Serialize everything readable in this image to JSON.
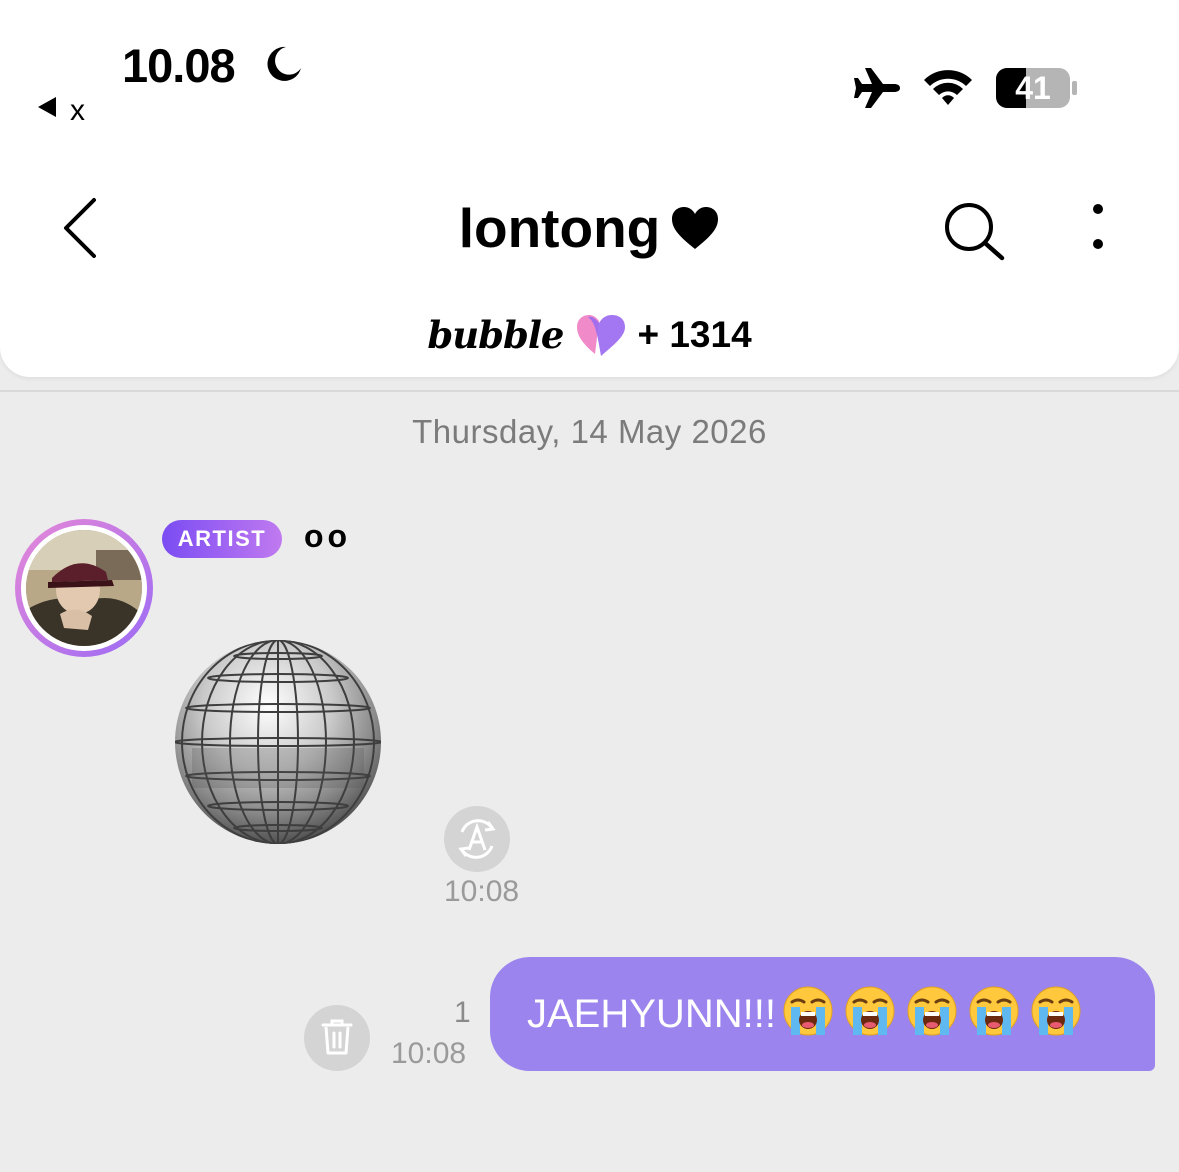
{
  "status_bar": {
    "time": "10.08",
    "back_app_label": "x",
    "battery_level": "41",
    "icons": [
      "moon-icon",
      "back-triangle-icon",
      "airplane-icon",
      "wifi-icon",
      "battery-icon"
    ]
  },
  "header": {
    "title": "lontong",
    "title_icon": "heart-icon",
    "icons": [
      "back-chevron-icon",
      "search-icon",
      "more-vertical-icon"
    ],
    "bubble": {
      "logo_text": "bubble",
      "count": "+ 1314"
    }
  },
  "chat": {
    "date": "Thursday, 14 May 2026",
    "incoming": {
      "badge": "ARTIST",
      "sender_name": "oo",
      "sticker": "disco-ball",
      "time": "10:08",
      "action_icon": "auto-translate-icon"
    },
    "outgoing": {
      "text": "JAEHYUNN!!!",
      "emoji": [
        "loudly-crying-face",
        "loudly-crying-face",
        "loudly-crying-face",
        "loudly-crying-face",
        "loudly-crying-face"
      ],
      "unread_count": "1",
      "time": "10:08",
      "action_icon": "trash-icon"
    }
  },
  "colors": {
    "accent_purple": "#9c84ee",
    "badge_start": "#7b4cf3",
    "badge_end": "#c07af0",
    "background": "#ececec",
    "date_text": "#7b7b7b",
    "time_text": "#9a9a9a"
  }
}
